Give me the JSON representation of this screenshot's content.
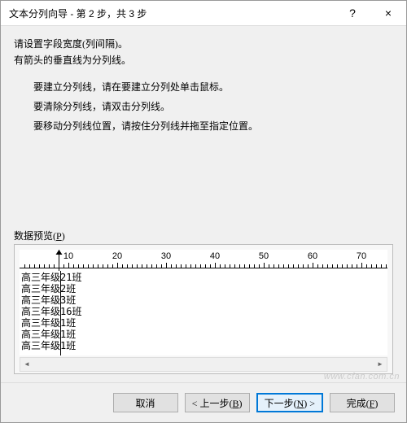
{
  "window": {
    "title": "文本分列向导 - 第 2 步，共 3 步",
    "help_label": "?",
    "close_label": "×"
  },
  "lead": {
    "l1": "请设置字段宽度(列间隔)。",
    "l2": "有箭头的垂直线为分列线。"
  },
  "instructions": {
    "l1": "要建立分列线，请在要建立分列处单击鼠标。",
    "l2": "要清除分列线，请双击分列线。",
    "l3": "要移动分列线位置，请按住分列线并拖至指定位置。"
  },
  "preview": {
    "label_pre": "数据预览(",
    "label_key": "P",
    "label_post": ")",
    "ticks": [
      10,
      20,
      30,
      40,
      50,
      60,
      70
    ],
    "break_at": 4,
    "rows": [
      "高三年级21班",
      "高三年级2班",
      "高三年级3班",
      "高三年级16班",
      "高三年级1班",
      "高三年级1班",
      "高三年级1班"
    ]
  },
  "buttons": {
    "cancel": "取消",
    "back_pre": "< 上一步(",
    "back_key": "B",
    "back_post": ")",
    "next_pre": "下一步(",
    "next_key": "N",
    "next_post": ") >",
    "finish_pre": "完成(",
    "finish_key": "F",
    "finish_post": ")"
  },
  "watermark": "www.cfan.com.cn"
}
